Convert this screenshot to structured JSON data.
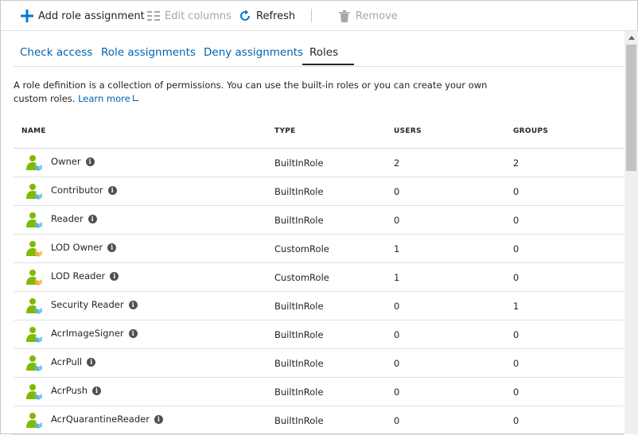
{
  "toolbar": {
    "add": "Add role assignment",
    "edit_columns": "Edit columns",
    "refresh": "Refresh",
    "remove": "Remove"
  },
  "tabs": [
    {
      "label": "Check access",
      "active": false
    },
    {
      "label": "Role assignments",
      "active": false
    },
    {
      "label": "Deny assignments",
      "active": false
    },
    {
      "label": "Roles",
      "active": true
    }
  ],
  "description": {
    "text": "A role definition is a collection of permissions. You can use the built-in roles or you can create your own custom roles.",
    "link": "Learn more"
  },
  "table": {
    "columns": [
      "NAME",
      "TYPE",
      "USERS",
      "GROUPS"
    ],
    "rows": [
      {
        "name": "Owner",
        "type": "BuiltInRole",
        "users": "2",
        "groups": "2"
      },
      {
        "name": "Contributor",
        "type": "BuiltInRole",
        "users": "0",
        "groups": "0"
      },
      {
        "name": "Reader",
        "type": "BuiltInRole",
        "users": "0",
        "groups": "0"
      },
      {
        "name": "LOD Owner",
        "type": "CustomRole",
        "users": "1",
        "groups": "0"
      },
      {
        "name": "LOD Reader",
        "type": "CustomRole",
        "users": "1",
        "groups": "0"
      },
      {
        "name": "Security Reader",
        "type": "BuiltInRole",
        "users": "0",
        "groups": "1"
      },
      {
        "name": "AcrImageSigner",
        "type": "BuiltInRole",
        "users": "0",
        "groups": "0"
      },
      {
        "name": "AcrPull",
        "type": "BuiltInRole",
        "users": "0",
        "groups": "0"
      },
      {
        "name": "AcrPush",
        "type": "BuiltInRole",
        "users": "0",
        "groups": "0"
      },
      {
        "name": "AcrQuarantineReader",
        "type": "BuiltInRole",
        "users": "0",
        "groups": "0"
      }
    ]
  },
  "icons": {
    "add": "plus-icon",
    "edit_columns": "columns-icon",
    "refresh": "refresh-icon",
    "remove": "trash-icon",
    "role": "role-user-cube-icon",
    "info": "info-icon"
  },
  "colors": {
    "link": "#0062ad",
    "accent": "#0078d4",
    "role_green": "#7fba00",
    "role_cube_blue": "#59b4d9",
    "role_cube_orange": "#f8a942"
  }
}
